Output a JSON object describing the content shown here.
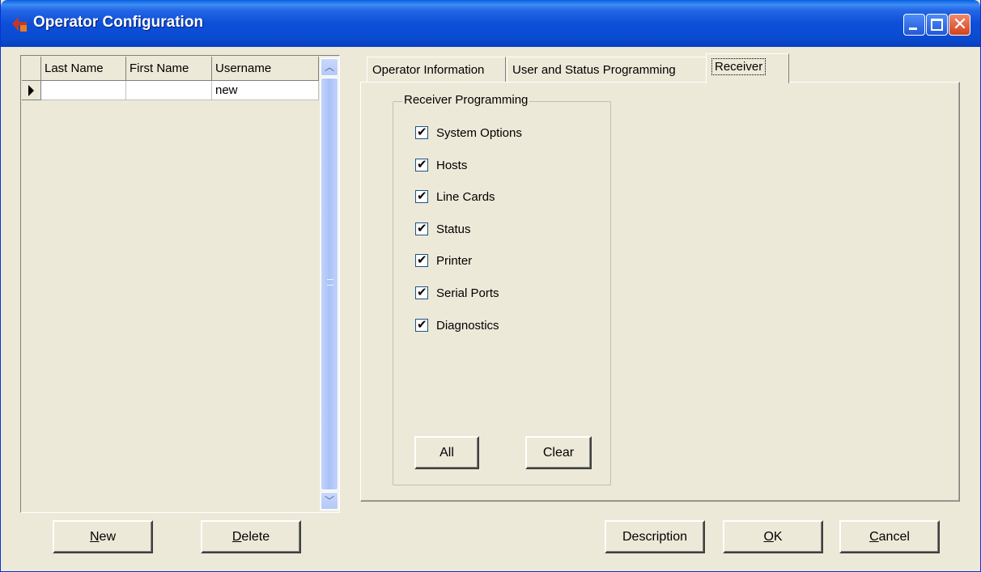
{
  "window": {
    "title": "Operator Configuration"
  },
  "grid": {
    "columns": [
      "Last Name",
      "First Name",
      "Username"
    ],
    "rows": [
      [
        "",
        "",
        "new"
      ]
    ]
  },
  "tabs": [
    {
      "label": "Operator Information",
      "active": false
    },
    {
      "label": "User and Status Programming",
      "active": false
    },
    {
      "label": "Receiver",
      "active": true
    }
  ],
  "receiver": {
    "group_title": "Receiver Programming",
    "options": [
      {
        "label": "System Options",
        "checked": true
      },
      {
        "label": "Hosts",
        "checked": true
      },
      {
        "label": "Line Cards",
        "checked": true
      },
      {
        "label": "Status",
        "checked": true
      },
      {
        "label": "Printer",
        "checked": true
      },
      {
        "label": "Serial Ports",
        "checked": true
      },
      {
        "label": "Diagnostics",
        "checked": true
      }
    ],
    "all_label": "All",
    "clear_label": "Clear"
  },
  "buttons": {
    "new": {
      "accel": "N",
      "rest": "ew"
    },
    "delete": {
      "accel": "D",
      "rest": "elete"
    },
    "description": "Description",
    "ok": {
      "accel": "O",
      "rest": "K"
    },
    "cancel": {
      "accel": "C",
      "rest": "ancel"
    }
  },
  "colors": {
    "titlebar": "#0a4bd0",
    "face": "#ece9d8"
  }
}
